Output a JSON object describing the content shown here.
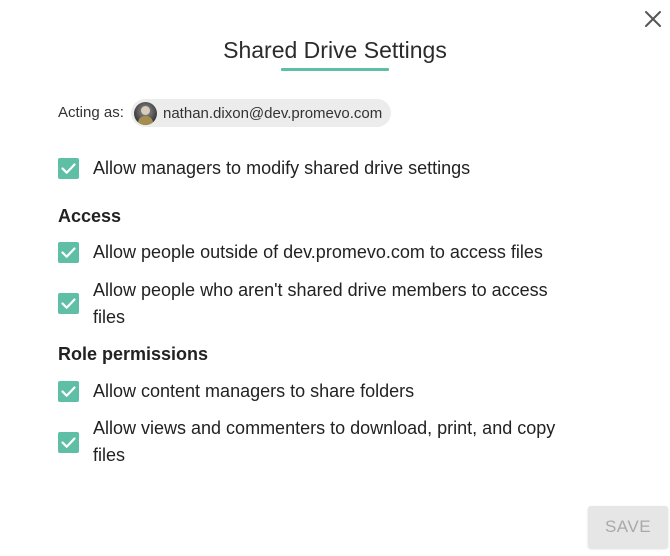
{
  "dialog": {
    "title": "Shared Drive Settings",
    "close_icon": "close-icon",
    "accent_color": "#5fbfa6"
  },
  "acting_as": {
    "label": "Acting as:",
    "email": "nathan.dixon@dev.promevo.com",
    "avatar_icon": "user-avatar"
  },
  "general": {
    "items": [
      {
        "label": "Allow managers to modify shared drive settings",
        "checked": true
      }
    ]
  },
  "access": {
    "heading": "Access",
    "items": [
      {
        "label": "Allow people outside of dev.promevo.com to access files",
        "checked": true
      },
      {
        "label": "Allow people who aren't shared drive members to access files",
        "checked": true
      }
    ]
  },
  "role_permissions": {
    "heading": "Role permissions",
    "items": [
      {
        "label": "Allow content managers to share folders",
        "checked": true
      },
      {
        "label": "Allow views and commenters to download, print, and copy files",
        "checked": true
      }
    ]
  },
  "footer": {
    "save_label": "SAVE",
    "save_enabled": false
  }
}
